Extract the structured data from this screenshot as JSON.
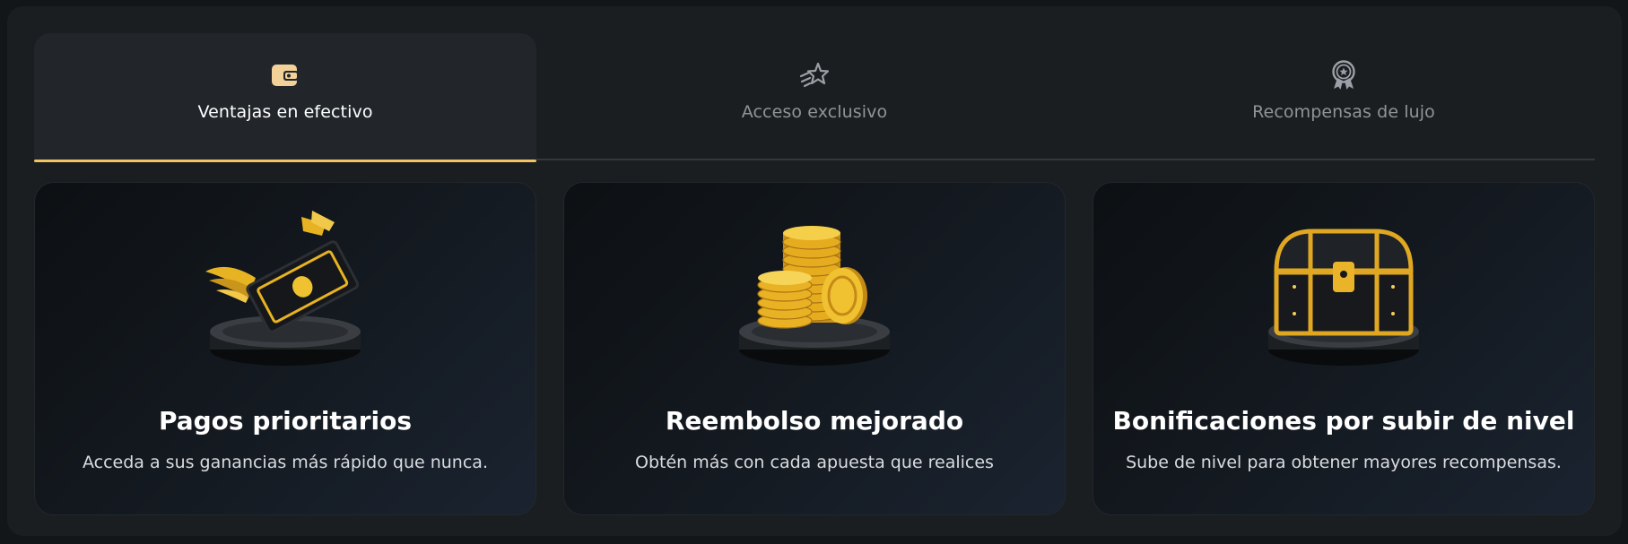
{
  "tabs": [
    {
      "label": "Ventajas en efectivo",
      "icon": "wallet-icon",
      "active": true
    },
    {
      "label": "Acceso exclusivo",
      "icon": "shooting-star-icon",
      "active": false
    },
    {
      "label": "Recompensas de lujo",
      "icon": "award-badge-icon",
      "active": false
    }
  ],
  "cards": [
    {
      "title": "Pagos prioritarios",
      "text": "Acceda a sus ganancias más rápido que nunca.",
      "image": "winged-banknote-on-pedestal"
    },
    {
      "title": "Reembolso mejorado",
      "text": "Obtén más con cada apuesta que realices",
      "image": "gold-coin-stacks-on-pedestal"
    },
    {
      "title": "Bonificaciones por subir de nivel",
      "text": "Sube de nivel para obtener mayores recompensas.",
      "image": "treasure-chest-on-pedestal"
    }
  ],
  "colors": {
    "accent": "#f0c463",
    "panel": "#1b1e21",
    "tab_active_bg": "#22262a",
    "gold": "#e5b32a"
  }
}
